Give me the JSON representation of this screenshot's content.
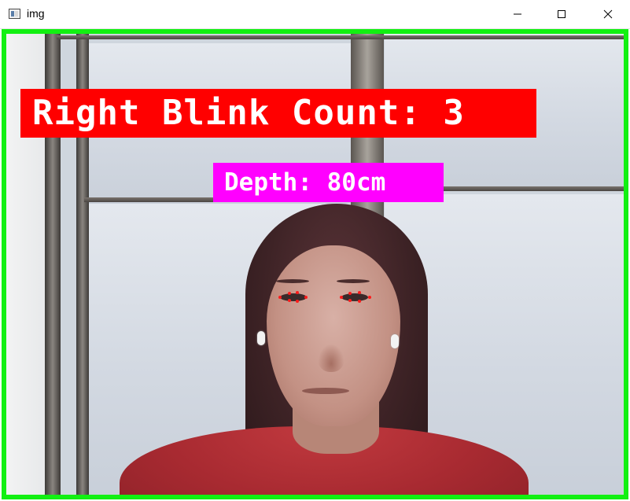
{
  "window": {
    "title": "img",
    "icons": {
      "app": "app-window-icon",
      "minimize": "minimize-icon",
      "maximize": "maximize-icon",
      "close": "close-icon"
    }
  },
  "overlays": {
    "blink_count_text": "Right Blink Count: 3",
    "depth_text": "Depth: 80cm"
  },
  "colors": {
    "frame_border": "#12f012",
    "blink_label_bg": "#ff0000",
    "depth_label_bg": "#ff00ff",
    "landmark": "#ff1a1a"
  }
}
